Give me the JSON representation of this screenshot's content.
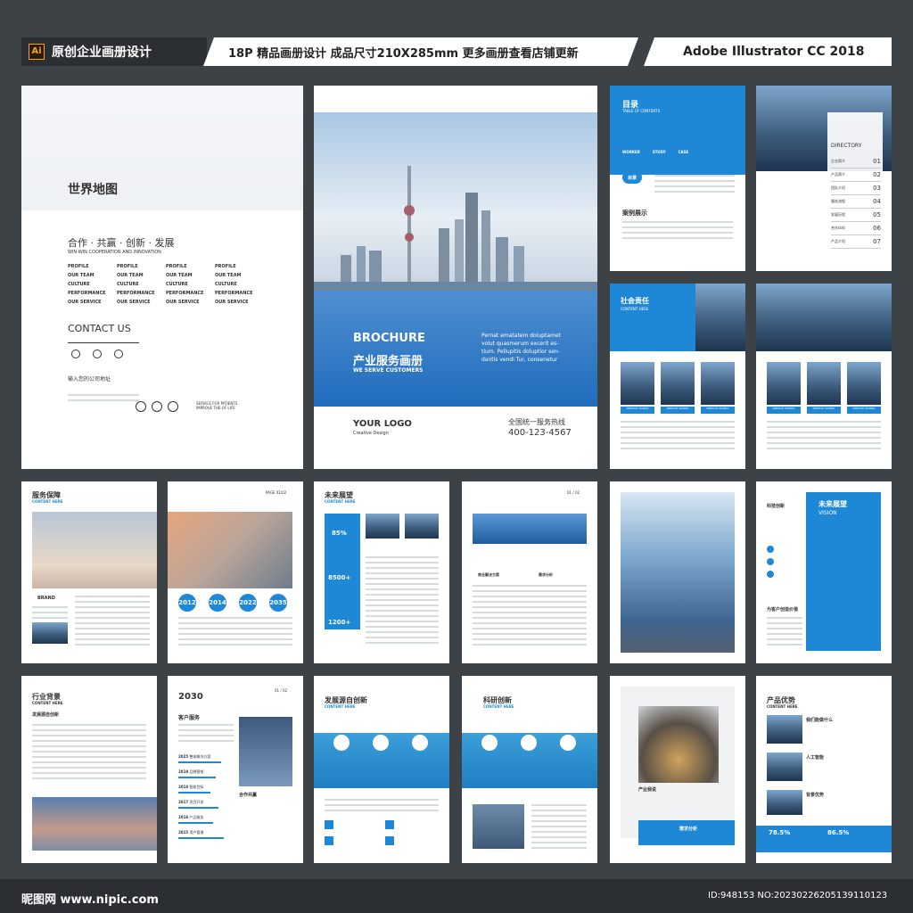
{
  "header": {
    "ai_badge": "Ai",
    "left": "原创企业画册设计",
    "center": "18P 精品画册设计 成品尺寸210X285mm 更多画册查看店铺更新",
    "right": "Adobe Illustrator CC 2018"
  },
  "p1": {
    "title": "世界地图",
    "slogan": "合作 · 共赢 · 创新 · 发展",
    "slogan_en": "WIN-WIN COOPERATION AND INNOVATION",
    "contact": "CONTACT US",
    "address": "输入您的公司地址",
    "service": "SERVICE FOR PATIENTS\nIMPROVE THE OF LIFE",
    "list": [
      "PROFILE",
      "OUR TEAM",
      "CULTURE",
      "PERFORMANCE",
      "OUR SERVICE"
    ]
  },
  "cover": {
    "brochure": "BROCHURE",
    "title_cn": "产业服务画册",
    "subtitle": "WE SERVE CUSTOMERS",
    "blurb": "Pernat ematatem doluptamet\nvolut quasmerum excerit es-\ntium. Pellupitis doluptior sen-\ndantis vendi Tur, consenetur",
    "logo": "YOUR LOGO",
    "logo_sub": "Creative Design",
    "hotline_label": "全国统一服务热线",
    "hotline": "400-123-4567"
  },
  "p3": {
    "title": "目录",
    "subtitle": "TABLE OF CONTENTS",
    "tabs": [
      "WORKER",
      "STUDY",
      "CASE"
    ],
    "badge": "目录",
    "case_title": "案例展示"
  },
  "p4": {
    "title": "DIRECTORY",
    "items": [
      {
        "label": "企业简介",
        "num": "01"
      },
      {
        "label": "产品简介",
        "num": "02"
      },
      {
        "label": "团队介绍",
        "num": "03"
      },
      {
        "label": "服务流程",
        "num": "04"
      },
      {
        "label": "发展历程",
        "num": "05"
      },
      {
        "label": "合作伙伴",
        "num": "06"
      },
      {
        "label": "产品介绍",
        "num": "07"
      }
    ]
  },
  "p5": {
    "title": "社会责任",
    "sub": "CONTENT HERE",
    "tag": "SERVICE WORKS"
  },
  "p9": {
    "title": "服务保障",
    "sub": "CONTENT HERE",
    "brand": "BRAND"
  },
  "p10": {
    "page": "PAGE 01/02",
    "years": [
      "2012",
      "2014",
      "2022",
      "2035"
    ]
  },
  "p11": {
    "title": "未来展望",
    "sub": "CONTENT HERE",
    "stats": [
      "85%",
      "8500+",
      "1200+"
    ]
  },
  "p12": {
    "page": "01 / 02",
    "items": [
      "商业解决方案",
      "需求分析"
    ]
  },
  "p14": {
    "title": "科技创新",
    "vision_cn": "未来展望",
    "vision": "VISION",
    "clients": "为客户创造价值"
  },
  "p15": {
    "title": "行业背景",
    "sub": "CONTENT HERE",
    "sub2": "发展源自创新"
  },
  "p16": {
    "year": "2030",
    "page": "01 / 02",
    "services": "客户服务",
    "partner": "合作共赢",
    "timeline": [
      {
        "y": "2025",
        "t": "整体解决方案"
      },
      {
        "y": "2019",
        "t": "品牌营销"
      },
      {
        "y": "2018",
        "t": "智能目标"
      },
      {
        "y": "2017",
        "t": "项目开发"
      },
      {
        "y": "2016",
        "t": "产品服务"
      },
      {
        "y": "2015",
        "t": "用户管理"
      }
    ]
  },
  "p17": {
    "title": "发展源自创新",
    "sub": "CONTENT HERE"
  },
  "p18": {
    "title": "科研创新",
    "sub": "CONTENT HERE"
  },
  "p19": {
    "chess": "产业我说",
    "label": "需求分析"
  },
  "p20": {
    "title": "产品优势",
    "sub": "CONTENT HERE",
    "items": [
      "我们能做什么",
      "人工智能",
      "背景优势"
    ],
    "stats": [
      "78.5%",
      "86.5%"
    ]
  },
  "footer": {
    "logo": "昵图网 www.nipic.com",
    "id": "ID:948153 NO:20230226205139110123"
  }
}
